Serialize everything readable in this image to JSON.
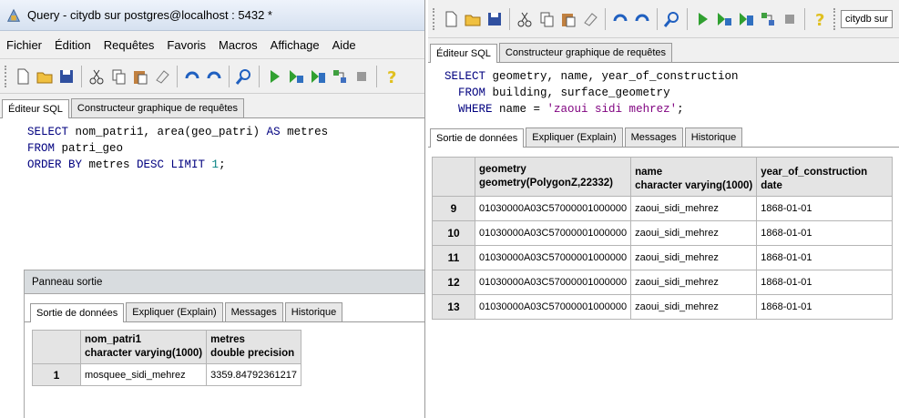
{
  "left": {
    "title": "Query - citydb sur postgres@localhost : 5432 *",
    "menu": [
      "Fichier",
      "Édition",
      "Requêtes",
      "Favoris",
      "Macros",
      "Affichage",
      "Aide"
    ],
    "editor_tabs": [
      "Éditeur SQL",
      "Constructeur graphique de requêtes"
    ],
    "sql": {
      "line1_kw": "SELECT",
      "line1_rest": " nom_patri1, area(geo_patri) ",
      "line1_kw2": "AS",
      "line1_rest2": " metres",
      "line2_kw": "FROM",
      "line2_rest": " patri_geo",
      "line3_kw": "ORDER BY",
      "line3_rest": " metres ",
      "line3_kw2": "DESC LIMIT",
      "line3_num": " 1",
      "line3_end": ";"
    },
    "output_panel_title": "Panneau sortie",
    "output_tabs": [
      "Sortie de données",
      "Expliquer (Explain)",
      "Messages",
      "Historique"
    ],
    "columns": [
      {
        "name": "nom_patri1",
        "type": "character varying(1000)"
      },
      {
        "name": "metres",
        "type": "double precision"
      }
    ],
    "rows": [
      {
        "num": "1",
        "cells": [
          "mosquee_sidi_mehrez",
          "3359.84792361217"
        ]
      }
    ]
  },
  "right": {
    "toolbar_db": "citydb sur",
    "editor_tabs": [
      "Éditeur SQL",
      "Constructeur graphique de requêtes"
    ],
    "sql": {
      "line1_kw": "SELECT",
      "line1_rest": " geometry, name, year_of_construction",
      "line2_kw": "FROM",
      "line2_rest": " building, surface_geometry",
      "line3_kw": "WHERE",
      "line3_rest": " name = ",
      "line3_str": "'zaoui sidi mehrez'",
      "line3_end": ";"
    },
    "output_tabs": [
      "Sortie de données",
      "Expliquer (Explain)",
      "Messages",
      "Historique"
    ],
    "columns": [
      {
        "name": "geometry",
        "type": "geometry(PolygonZ,22332)"
      },
      {
        "name": "name",
        "type": "character varying(1000)"
      },
      {
        "name": "year_of_construction",
        "type": "date"
      }
    ],
    "rows": [
      {
        "num": "9",
        "cells": [
          "01030000A03C57000001000000",
          "zaoui_sidi_mehrez",
          "1868-01-01"
        ]
      },
      {
        "num": "10",
        "cells": [
          "01030000A03C57000001000000",
          "zaoui_sidi_mehrez",
          "1868-01-01"
        ]
      },
      {
        "num": "11",
        "cells": [
          "01030000A03C57000001000000",
          "zaoui_sidi_mehrez",
          "1868-01-01"
        ]
      },
      {
        "num": "12",
        "cells": [
          "01030000A03C57000001000000",
          "zaoui_sidi_mehrez",
          "1868-01-01"
        ]
      },
      {
        "num": "13",
        "cells": [
          "01030000A03C57000001000000",
          "zaoui_sidi_mehrez",
          "1868-01-01"
        ]
      }
    ]
  },
  "colors": {
    "keyword": "#00007f",
    "string": "#7f007f",
    "number": "#007f7f",
    "titlebar": "#dbe5f2"
  }
}
